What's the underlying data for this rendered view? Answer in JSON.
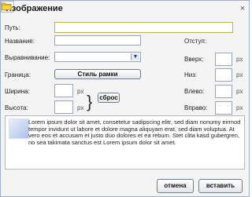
{
  "dialog": {
    "title": "Изображение",
    "close_glyph": "×"
  },
  "fields": {
    "path_label": "Путь:",
    "path_value": "",
    "name_label": "Название:",
    "name_value": "",
    "align_label": "Выравнивание:",
    "align_value": "",
    "border_label": "Граница:",
    "border_button": "Стиль рамки",
    "width_label": "Ширина:",
    "width_value": "",
    "width_unit": "px",
    "height_label": "Высота:",
    "height_value": "",
    "height_unit": "px",
    "reset_button": "сброс"
  },
  "indent": {
    "title": "Отступ:",
    "top_label": "Вверх:",
    "top_value": "",
    "top_unit": "px",
    "bottom_label": "Низ:",
    "bottom_value": "",
    "bottom_unit": "px",
    "left_label": "Влево:",
    "left_value": "",
    "left_unit": "px",
    "right_label": "Вправо:",
    "right_value": "",
    "right_unit": "px"
  },
  "preview": {
    "text": "Lorem ipsum dolor sit amet, consetetur sadipscing elitr, sed diam nonumy eirmod tempor invidunt ut labore et dolore magna aliquyam erat, sed diam voluptua. At vero eos et accusam et justo duo dolores et ea rebum. Stet clita kasd gubergren, no sea takimata sanctus est Lorem ipsum dolor sit amet."
  },
  "buttons": {
    "cancel": "отмена",
    "insert": "вставить"
  },
  "icons": {
    "folder": "folder-icon",
    "close": "close-icon",
    "dropdown": "chevron-down-icon"
  },
  "colors": {
    "border": "#9fb0c8",
    "path_field_border": "#d7b400",
    "folder_yellow": "#f0c419"
  }
}
